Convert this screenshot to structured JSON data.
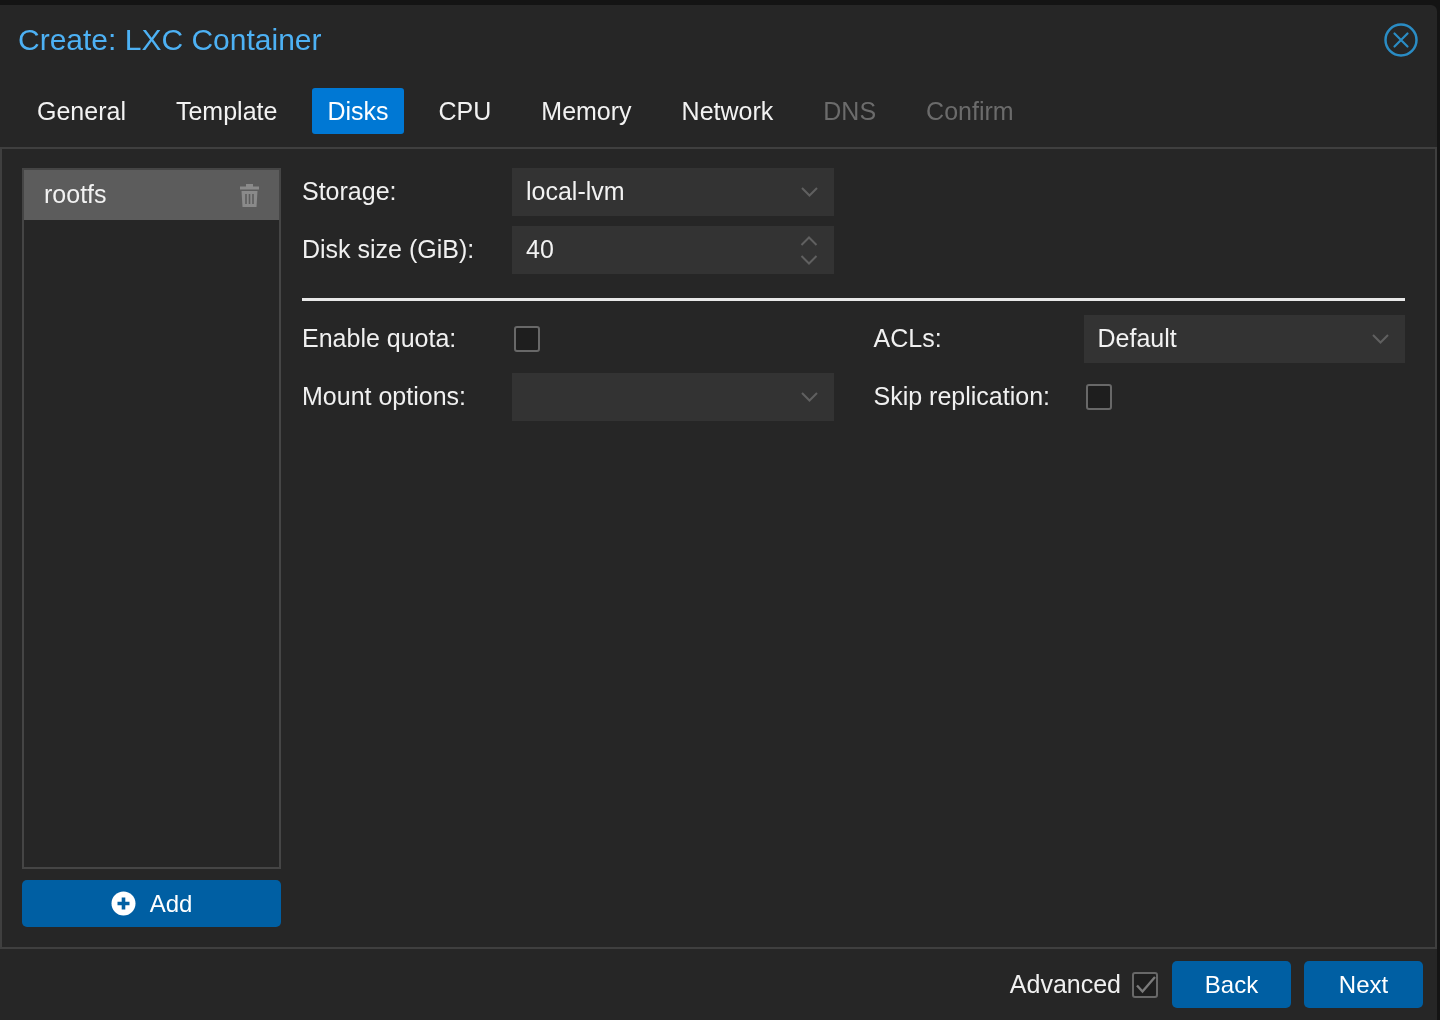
{
  "dialog": {
    "title": "Create: LXC Container"
  },
  "tabs": [
    {
      "label": "General",
      "selected": false,
      "disabled": false
    },
    {
      "label": "Template",
      "selected": false,
      "disabled": false
    },
    {
      "label": "Disks",
      "selected": true,
      "disabled": false
    },
    {
      "label": "CPU",
      "selected": false,
      "disabled": false
    },
    {
      "label": "Memory",
      "selected": false,
      "disabled": false
    },
    {
      "label": "Network",
      "selected": false,
      "disabled": false
    },
    {
      "label": "DNS",
      "selected": false,
      "disabled": true
    },
    {
      "label": "Confirm",
      "selected": false,
      "disabled": true
    }
  ],
  "disk_list": {
    "items": [
      {
        "label": "rootfs",
        "selected": true
      }
    ]
  },
  "add_button": {
    "label": "Add"
  },
  "fields": [
    {
      "kind": "combo",
      "label": "Storage:",
      "value": "local-lvm"
    },
    {
      "kind": "spinner",
      "label": "Disk size (GiB):",
      "value": "40"
    }
  ],
  "advanced_fields": {
    "left": [
      {
        "kind": "checkbox",
        "label": "Enable quota:",
        "checked": false
      },
      {
        "kind": "combo",
        "label": "Mount options:"
      }
    ],
    "right": [
      {
        "kind": "combo",
        "label": "ACLs:",
        "value": "Default"
      },
      {
        "kind": "checkbox",
        "label": "Skip replication:",
        "checked": false
      }
    ]
  },
  "footer": {
    "advanced": {
      "label": "Advanced",
      "checked": true
    },
    "buttons": [
      {
        "label": "Back"
      },
      {
        "label": "Next"
      }
    ]
  }
}
